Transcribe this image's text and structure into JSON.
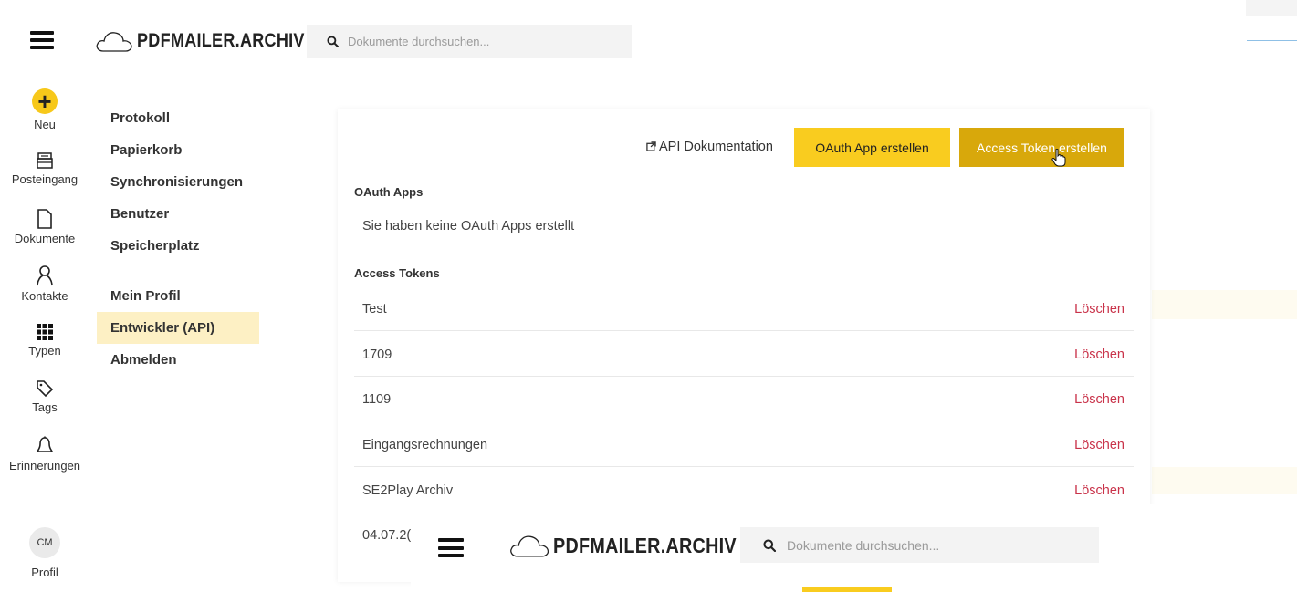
{
  "header": {
    "logo_text": "PDFMAILER.ARCHIV",
    "search_placeholder": "Dokumente durchsuchen..."
  },
  "rail": {
    "new_label": "Neu",
    "inbox_label": "Posteingang",
    "documents_label": "Dokumente",
    "contacts_label": "Kontakte",
    "types_label": "Typen",
    "tags_label": "Tags",
    "reminders_label": "Erinnerungen",
    "avatar_initials": "CM",
    "profile_label": "Profil"
  },
  "menu": {
    "items": [
      {
        "label": "Protokoll"
      },
      {
        "label": "Papierkorb"
      },
      {
        "label": "Synchronisierungen"
      },
      {
        "label": "Benutzer"
      },
      {
        "label": "Speicherplatz"
      },
      {
        "label": "Mein Profil"
      },
      {
        "label": "Entwickler (API)",
        "active": true
      },
      {
        "label": "Abmelden"
      }
    ]
  },
  "main": {
    "api_doc_label": "API Dokumentation",
    "oauth_button": "OAuth App erstellen",
    "token_button": "Access Token erstellen",
    "oauth_section_title": "OAuth Apps",
    "oauth_empty_text": "Sie haben keine OAuth Apps erstellt",
    "tokens_section_title": "Access Tokens",
    "delete_label": "Löschen",
    "tokens": [
      {
        "name": "Test"
      },
      {
        "name": "1709"
      },
      {
        "name": "1109"
      },
      {
        "name": "Eingangsrechnungen"
      },
      {
        "name": "SE2Play Archiv"
      },
      {
        "name": "04.07.2("
      }
    ]
  },
  "overlay": {
    "logo_text": "PDFMAILER.ARCHIV",
    "search_placeholder": "Dokumente durchsuchen..."
  },
  "colors": {
    "accent_yellow": "#f9cc1f",
    "accent_dark_yellow": "#d8a80b",
    "active_menu_bg": "#fdf0c4",
    "delete_red": "#c9334a"
  }
}
